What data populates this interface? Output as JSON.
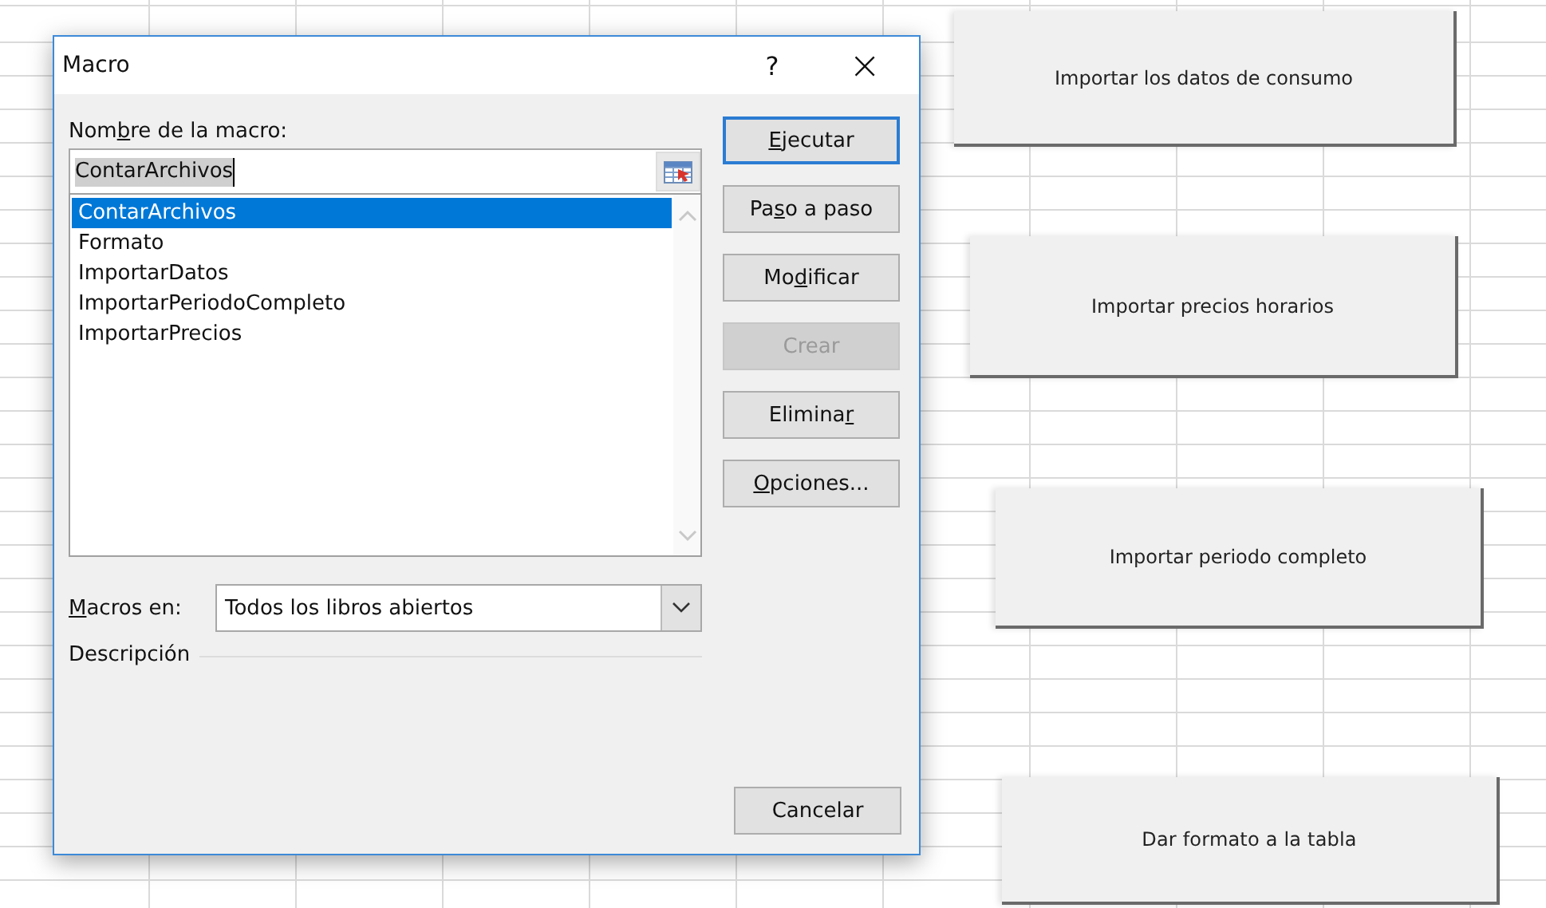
{
  "sheet_buttons": [
    {
      "label": "Importar los datos de consumo",
      "kind": "wide"
    },
    {
      "label": "Importar precios horarios",
      "kind": "wide"
    },
    {
      "label": "Importar periodo completo",
      "kind": "wide"
    },
    {
      "label": "Dar formato a la tabla",
      "kind": "short"
    }
  ],
  "dialog": {
    "title": "Macro",
    "help_button": "?",
    "close_button": "×",
    "name_label": {
      "pre": "Nom",
      "key": "b",
      "post": "re de la macro:"
    },
    "name_value": "ContarArchivos",
    "macros": [
      {
        "name": "ContarArchivos",
        "selected": true
      },
      {
        "name": "Formato",
        "selected": false
      },
      {
        "name": "ImportarDatos",
        "selected": false
      },
      {
        "name": "ImportarPeriodoCompleto",
        "selected": false
      },
      {
        "name": "ImportarPrecios",
        "selected": false
      }
    ],
    "location_label": {
      "key": "M",
      "post": "acros en:"
    },
    "location_value": "Todos los libros abiertos",
    "description_label": "Descripción",
    "buttons": [
      {
        "label": {
          "key": "E",
          "post": "jecutar"
        },
        "disabled": false,
        "default": true
      },
      {
        "label": {
          "pre": "Pa",
          "key": "s",
          "post": "o a paso"
        },
        "disabled": false,
        "default": false
      },
      {
        "label": {
          "pre": "Mo",
          "key": "d",
          "post": "ificar"
        },
        "disabled": false,
        "default": false
      },
      {
        "label": {
          "pre": "Crear"
        },
        "disabled": true,
        "default": false
      },
      {
        "label": {
          "pre": "Elimina",
          "key": "r"
        },
        "disabled": false,
        "default": false
      },
      {
        "label": {
          "key": "O",
          "post": "pciones..."
        },
        "disabled": false,
        "default": false
      }
    ],
    "cancel_button": "Cancelar"
  }
}
